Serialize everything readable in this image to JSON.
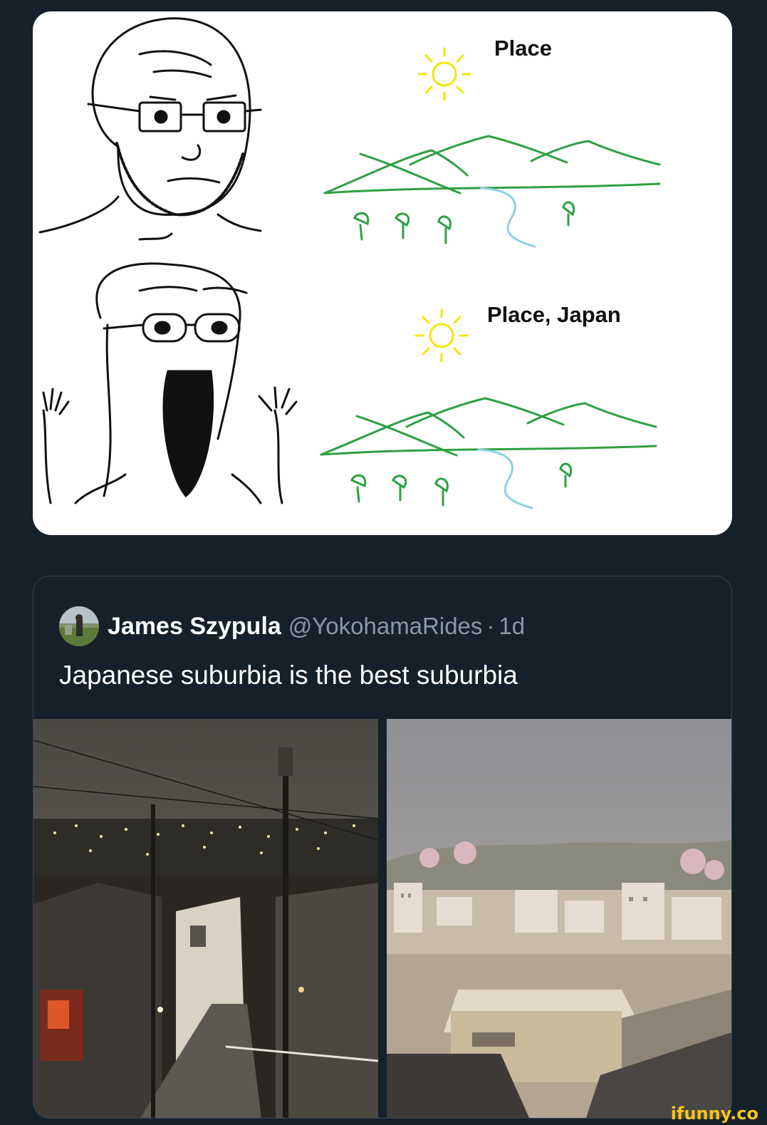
{
  "meme": {
    "panel_top_label": "Place",
    "panel_bottom_label": "Place, Japan"
  },
  "tweet": {
    "author_name": "James Szypula",
    "author_handle": "@YokohamaRides",
    "separator": "·",
    "timestamp": "1d",
    "text": "Japanese suburbia is the best suburbia"
  },
  "watermark": "ifunny.co",
  "colors": {
    "background": "#15202b",
    "card_border": "#38444d",
    "text_primary": "#ffffff",
    "text_secondary": "#8899a6",
    "watermark": "#f6c518"
  }
}
